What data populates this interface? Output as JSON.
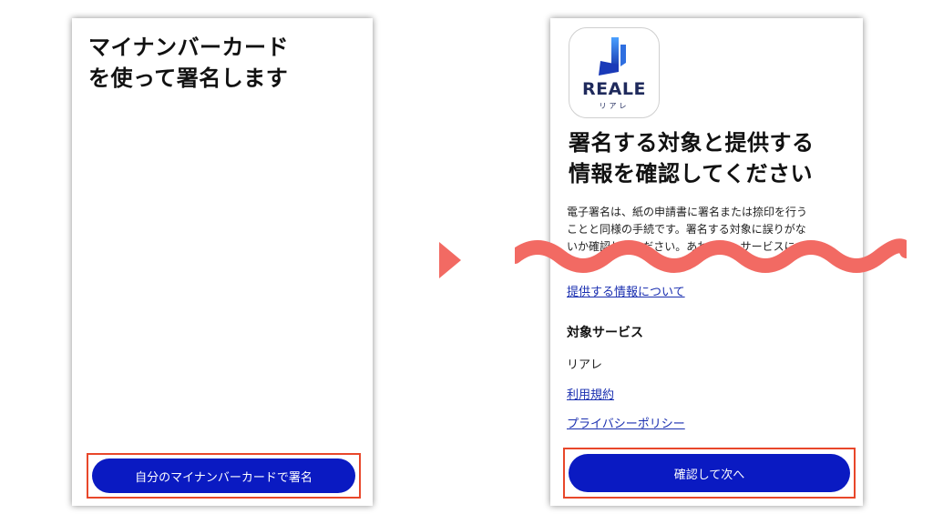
{
  "left": {
    "title": "マイナンバーカード\nを使って署名します",
    "sign_button": "自分のマイナンバーカードで署名"
  },
  "right": {
    "logo_text": "REALE",
    "logo_sub": "リアレ",
    "title": "署名する対象と提供する\n情報を確認してください",
    "description": "電子署名は、紙の申請書に署名または捺印を行う\nことと同様の手続です。署名する対象に誤りがな\nいか確認してください。あわせて、サービスに",
    "info_link": "提供する情報について",
    "service_heading": "対象サービス",
    "service_name": "リアレ",
    "terms_link": "利用規約",
    "privacy_link": "プライバシーポリシー",
    "next_button": "確認して次へ"
  },
  "colors": {
    "button": "#0a1ac2",
    "highlight": "#e8472a",
    "arrow": "#f26a63",
    "link": "#1a2fb0"
  }
}
